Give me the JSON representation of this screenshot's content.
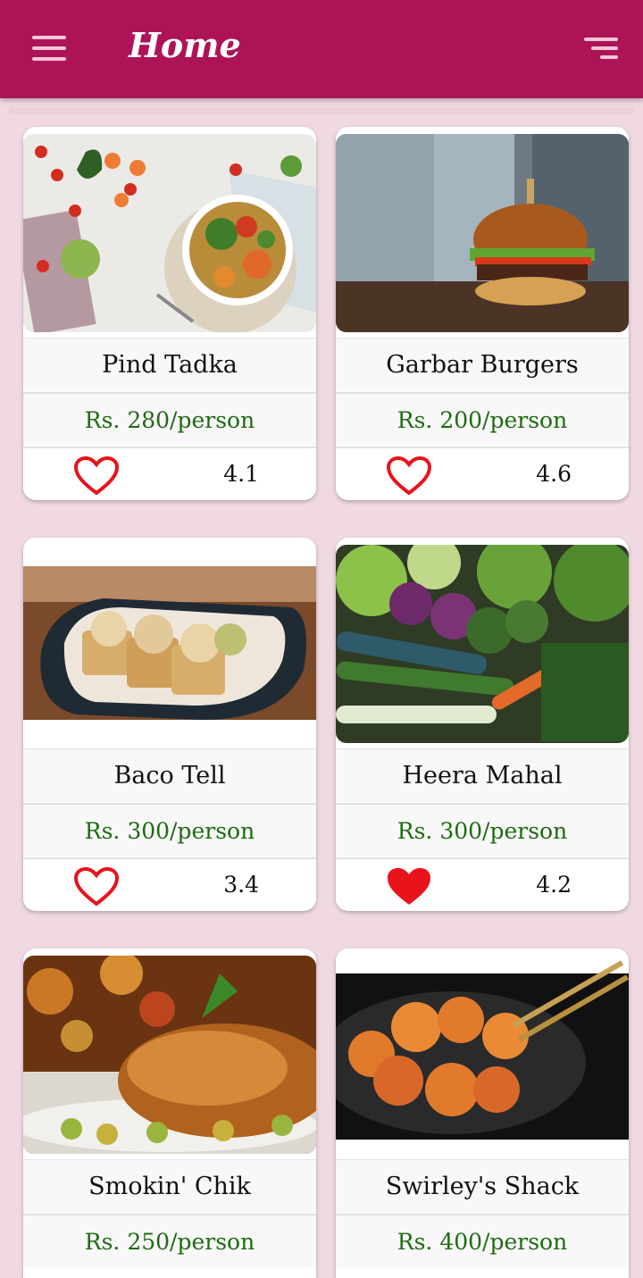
{
  "header": {
    "title": "Home",
    "menu_icon": "hamburger-menu-icon",
    "sort_icon": "sort-icon"
  },
  "colors": {
    "appbar": "#ad1457",
    "background": "#f0d9e3",
    "price": "#1e6b12",
    "heart": "#e8131b"
  },
  "restaurants": [
    {
      "name": "Pind Tadka",
      "price": "Rs. 280/person",
      "rating": "4.1",
      "favorite": false,
      "image": "salad-bowl-photo"
    },
    {
      "name": "Garbar Burgers",
      "price": "Rs. 200/person",
      "rating": "4.6",
      "favorite": false,
      "image": "burger-photo"
    },
    {
      "name": "Baco Tell",
      "price": "Rs. 300/person",
      "rating": "3.4",
      "favorite": false,
      "image": "tacos-photo"
    },
    {
      "name": "Heera Mahal",
      "price": "Rs. 300/person",
      "rating": "4.2",
      "favorite": true,
      "image": "vegetables-photo"
    },
    {
      "name": "Smokin' Chik",
      "price": "Rs. 250/person",
      "rating": "",
      "favorite": false,
      "image": "roast-chicken-photo"
    },
    {
      "name": "Swirley's Shack",
      "price": "Rs. 400/person",
      "rating": "",
      "favorite": false,
      "image": "shrimp-pan-photo"
    }
  ]
}
